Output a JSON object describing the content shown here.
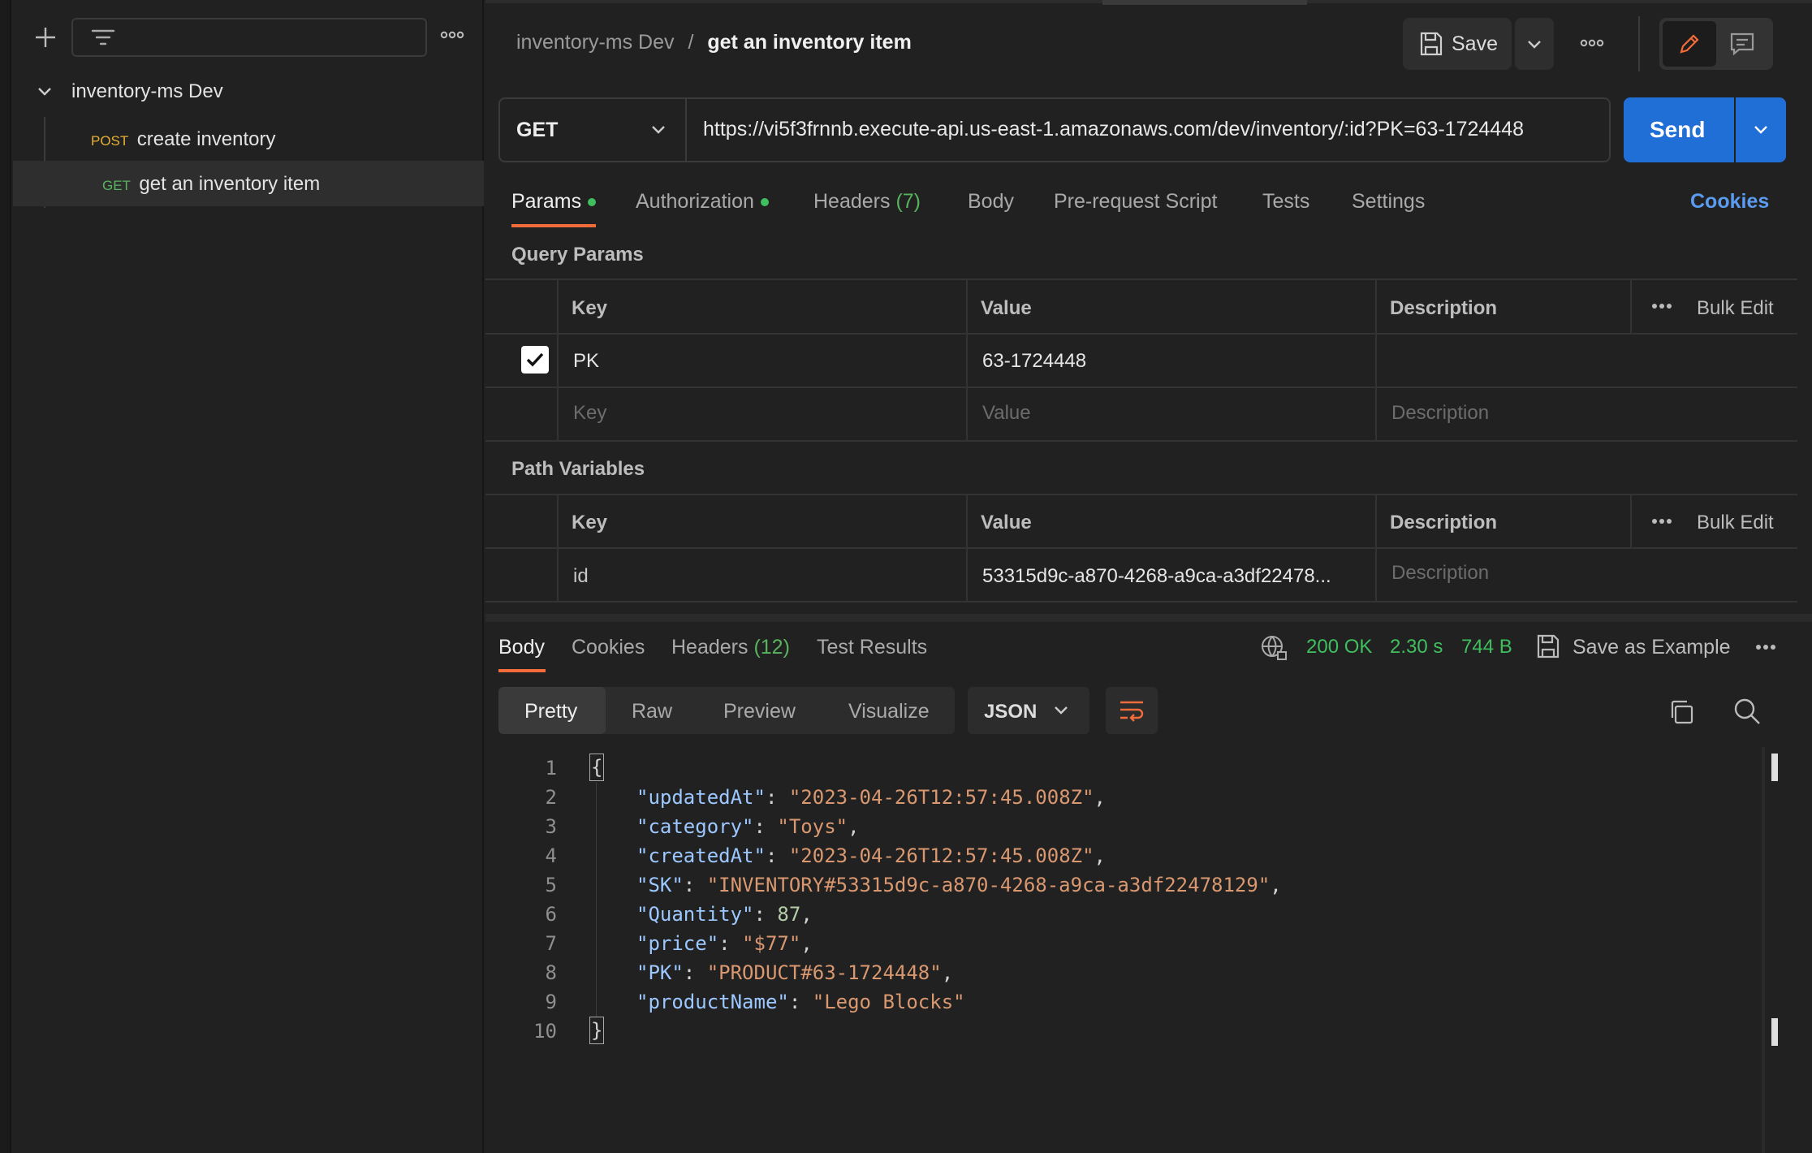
{
  "sidebar": {
    "collection_name": "inventory-ms Dev",
    "requests": [
      {
        "method": "POST",
        "name": "create inventory",
        "method_color": "#e6b035"
      },
      {
        "method": "GET",
        "name": "get an inventory item",
        "method_color": "#58b35f"
      }
    ]
  },
  "header": {
    "breadcrumb_parent": "inventory-ms Dev",
    "breadcrumb_sep": "/",
    "breadcrumb_current": "get an inventory item",
    "save_label": "Save"
  },
  "request": {
    "method": "GET",
    "url": "https://vi5f3frnnb.execute-api.us-east-1.amazonaws.com/dev/inventory/:id?PK=63-1724448",
    "send_label": "Send"
  },
  "request_tabs": {
    "params": "Params",
    "authorization": "Authorization",
    "headers": "Headers",
    "headers_count": "(7)",
    "body": "Body",
    "prerequest": "Pre-request Script",
    "tests": "Tests",
    "settings": "Settings",
    "cookies": "Cookies"
  },
  "query_params": {
    "title": "Query Params",
    "col_key": "Key",
    "col_value": "Value",
    "col_description": "Description",
    "bulk_edit": "Bulk Edit",
    "rows": [
      {
        "key": "PK",
        "value": "63-1724448",
        "description": "",
        "checked": true
      }
    ],
    "placeholder_key": "Key",
    "placeholder_value": "Value",
    "placeholder_description": "Description"
  },
  "path_variables": {
    "title": "Path Variables",
    "col_key": "Key",
    "col_value": "Value",
    "col_description": "Description",
    "bulk_edit": "Bulk Edit",
    "rows": [
      {
        "key": "id",
        "value": "53315d9c-a870-4268-a9ca-a3df22478...",
        "description_placeholder": "Description"
      }
    ]
  },
  "response_tabs": {
    "body": "Body",
    "cookies": "Cookies",
    "headers": "Headers",
    "headers_count": "(12)",
    "test_results": "Test Results"
  },
  "response_meta": {
    "status": "200 OK",
    "time": "2.30 s",
    "size": "744 B",
    "save_example": "Save as Example",
    "status_color": "#3fbf5e"
  },
  "view_modes": [
    "Pretty",
    "Raw",
    "Preview",
    "Visualize"
  ],
  "format_label": "JSON",
  "code": {
    "line_numbers": [
      "1",
      "2",
      "3",
      "4",
      "5",
      "6",
      "7",
      "8",
      "9",
      "10"
    ],
    "open_brace": "{",
    "close_brace": "}",
    "fields": [
      {
        "key": "\"updatedAt\"",
        "value": "\"2023-04-26T12:57:45.008Z\"",
        "type": "str",
        "comma": ","
      },
      {
        "key": "\"category\"",
        "value": "\"Toys\"",
        "type": "str",
        "comma": ","
      },
      {
        "key": "\"createdAt\"",
        "value": "\"2023-04-26T12:57:45.008Z\"",
        "type": "str",
        "comma": ","
      },
      {
        "key": "\"SK\"",
        "value": "\"INVENTORY#53315d9c-a870-4268-a9ca-a3df22478129\"",
        "type": "str",
        "comma": ","
      },
      {
        "key": "\"Quantity\"",
        "value": "87",
        "type": "num",
        "comma": ","
      },
      {
        "key": "\"price\"",
        "value": "\"$77\"",
        "type": "str",
        "comma": ","
      },
      {
        "key": "\"PK\"",
        "value": "\"PRODUCT#63-1724448\"",
        "type": "str",
        "comma": ","
      },
      {
        "key": "\"productName\"",
        "value": "\"Lego Blocks\"",
        "type": "str",
        "comma": ""
      }
    ]
  },
  "colors": {
    "accent": "#f26b3a",
    "send_blue": "#1f6fd6",
    "link_blue": "#5b9bf0"
  }
}
